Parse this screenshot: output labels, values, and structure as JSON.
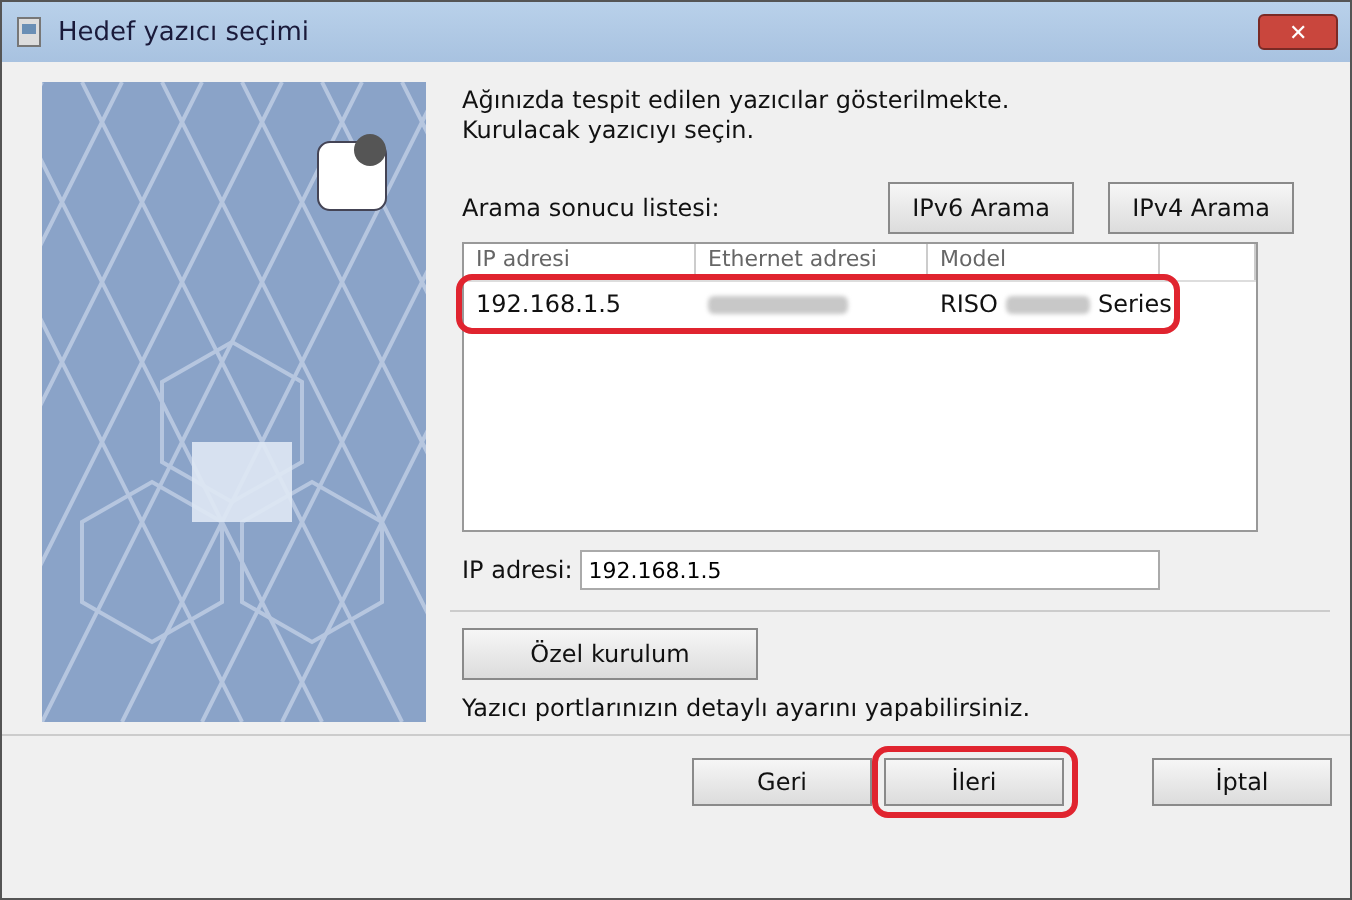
{
  "window": {
    "title": "Hedef yazıcı seçimi",
    "close": "✕"
  },
  "intro": [
    "Ağınızda tespit edilen yazıcılar gösterilmekte.",
    "Kurulacak yazıcıyı seçin."
  ],
  "search": {
    "label": "Arama sonucu listesi:",
    "buttons": [
      "IPv6 Arama",
      "IPv4 Arama"
    ]
  },
  "table": {
    "columns": [
      "IP adresi",
      "Ethernet adresi",
      "Model"
    ],
    "rows": [
      {
        "ip": "192.168.1.5",
        "model_prefix": "RISO",
        "model_suffix": "Series",
        "selected": false,
        "highlighted": true
      }
    ]
  },
  "ip_field": {
    "label": "IP adresi:",
    "value": "192.168.1.5"
  },
  "custom": {
    "button": "Özel kurulum",
    "note": "Yazıcı portlarınızın detaylı ayarını yapabilirsiniz."
  },
  "footer": [
    {
      "label": "Geri",
      "highlighted": false
    },
    {
      "label": "İleri",
      "highlighted": true
    },
    {
      "label": "İptal",
      "highlighted": false
    }
  ]
}
